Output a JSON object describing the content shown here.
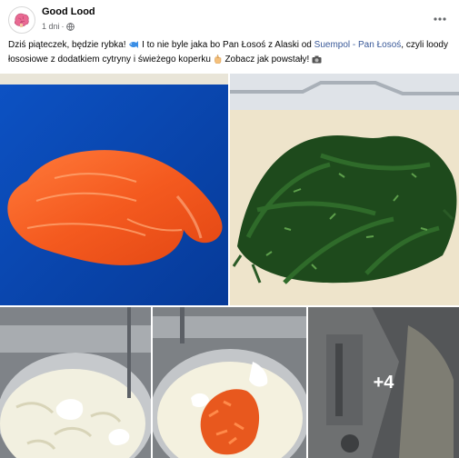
{
  "post": {
    "author": "Good Lood",
    "time": "1 dni",
    "privacy_icon": "globe-icon",
    "more_icon": "more-options-icon",
    "caption": {
      "part1": "Dziś piąteczek, będzie rybka!",
      "part2": "I to nie byle jaka bo Pan Łosoś z Alaski od",
      "link": "Suempol - Pan Łosoś",
      "part3": ",",
      "part4": "czyli loody łososiowe z dodatkiem cytryny i świeżego koperku",
      "part5": "Zobacz jak powstały!"
    }
  },
  "gallery": {
    "more_count": "+4"
  }
}
